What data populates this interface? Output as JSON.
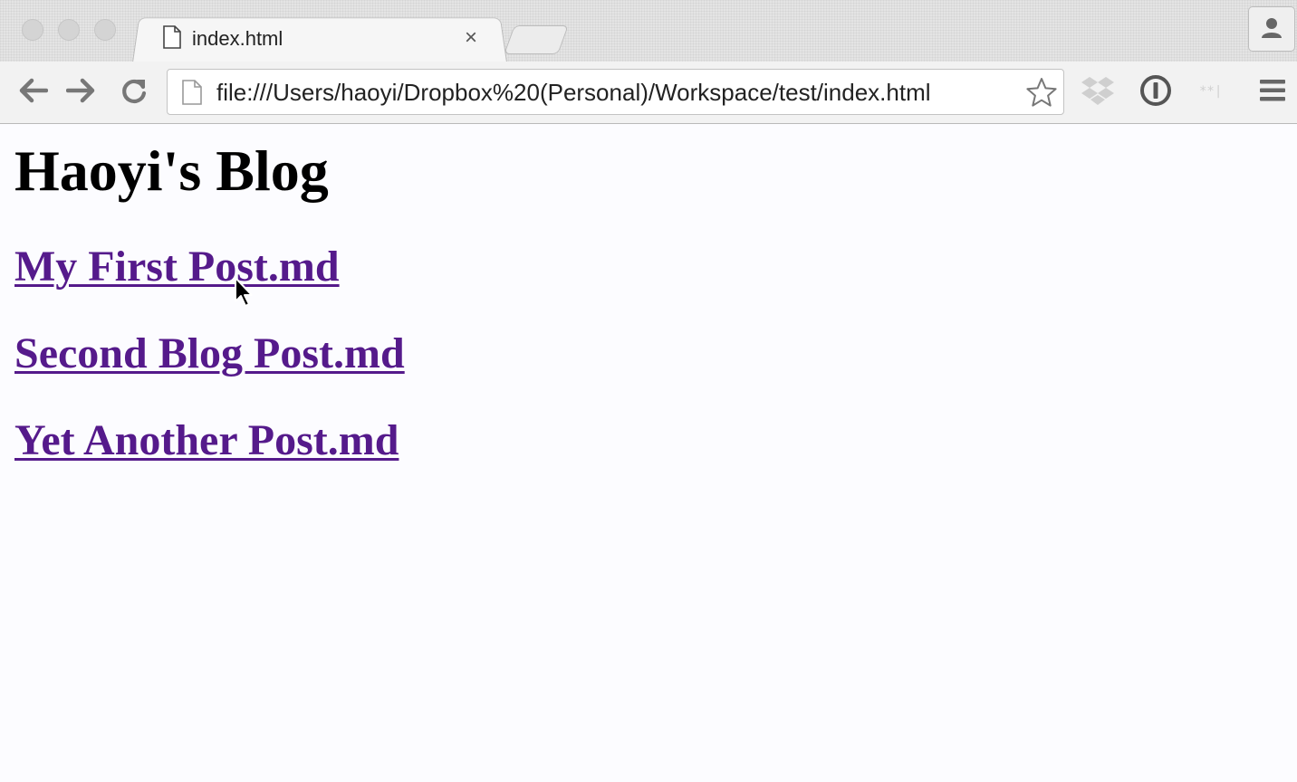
{
  "browser": {
    "tab": {
      "title": "index.html",
      "close_glyph": "×"
    },
    "address_bar": {
      "url": "file:///Users/haoyi/Dropbox%20(Personal)/Workspace/test/index.html"
    },
    "icons": {
      "back": "arrow-left-icon",
      "forward": "arrow-right-icon",
      "reload": "reload-icon",
      "star": "star-icon",
      "dropbox": "dropbox-icon",
      "onepassword": "onepassword-icon",
      "extension": "extension-icon",
      "menu": "hamburger-menu-icon",
      "profile": "person-icon"
    }
  },
  "page": {
    "title": "Haoyi's Blog",
    "links": [
      {
        "label": "My First Post.md"
      },
      {
        "label": "Second Blog Post.md"
      },
      {
        "label": "Yet Another Post.md"
      }
    ]
  },
  "colors": {
    "visited_link": "#551a8b",
    "heading": "#000000",
    "page_background": "#fcfcff"
  }
}
